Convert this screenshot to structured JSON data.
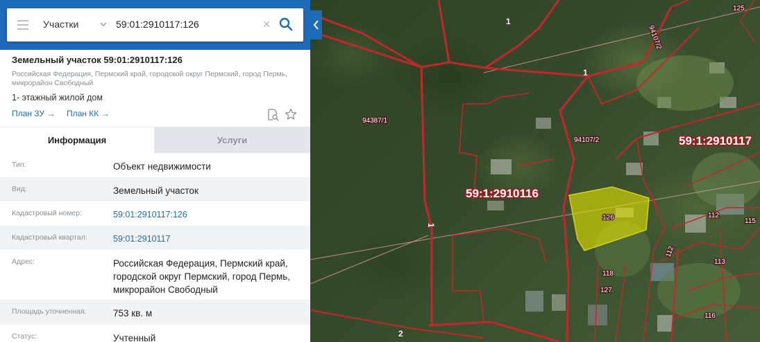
{
  "search": {
    "scope": "Участки",
    "query": "59:01:2910117:126"
  },
  "parcel": {
    "title": "Земельный участок 59:01:2910117:126",
    "address_line": "Российская Федерация, Пермский край, городской округ Пермский, город Пермь, микрорайон Свободный",
    "description": "1- этажный жилой дом",
    "links": [
      "План ЗУ →",
      "План КК →"
    ]
  },
  "tabs": [
    "Информация",
    "Услуги"
  ],
  "info_rows": [
    {
      "key": "Тип:",
      "value": "Объект недвижимости"
    },
    {
      "key": "Вид:",
      "value": "Земельный участок"
    },
    {
      "key": "Кадастровый номер:",
      "value": "59:01:2910117:126"
    },
    {
      "key": "Кадастровый квартал:",
      "value": "59:01:2910117"
    },
    {
      "key": "Адрес:",
      "value": "Российская Федерация, Пермский край, городской округ Пермский, город Пермь, микрорайон Свободный"
    },
    {
      "key": "Площадь уточненная:",
      "value": "753 кв. м"
    },
    {
      "key": "Статус:",
      "value": "Учтенный"
    }
  ],
  "map_labels": {
    "quarter_left": "59:1:2910116",
    "quarter_right": "59:1:2910117",
    "selected_parcel": "126",
    "parcel_94387": "94387/1",
    "parcel_94107_2": "94107/2",
    "parcel_94107_2_vertical": "94107/2",
    "n1_top": "1",
    "n1_mid": "1",
    "n1_vertical": "1",
    "n2": "2",
    "n112a": "112",
    "n112b": "112",
    "n113": "113",
    "n115": "115",
    "n116": "116",
    "n118": "118",
    "n125": "125",
    "n127": "127"
  },
  "colors": {
    "accent": "#1e6bb8",
    "boundary": "#c0282d",
    "selection_fill": "#e8e600"
  }
}
